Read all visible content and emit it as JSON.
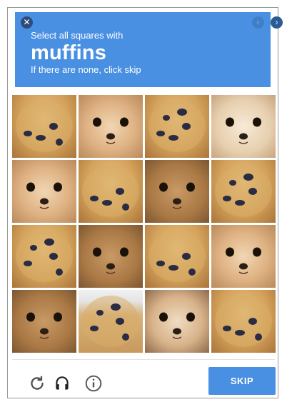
{
  "header": {
    "instruction_line": "Select all squares with",
    "target_word": "muffins",
    "hint_line": "If there are none, click skip",
    "close_icon": "close-icon",
    "prev_icon": "chevron-left-icon",
    "next_icon": "chevron-right-icon"
  },
  "grid": {
    "tiles": [
      {
        "kind": "muffin",
        "subject": "blueberry muffin"
      },
      {
        "kind": "dog",
        "subject": "chihuahua"
      },
      {
        "kind": "muffin",
        "subject": "blueberry muffin"
      },
      {
        "kind": "dog",
        "subject": "chihuahua"
      },
      {
        "kind": "dog",
        "subject": "chihuahua"
      },
      {
        "kind": "muffin",
        "subject": "blueberry muffin"
      },
      {
        "kind": "dog",
        "subject": "chihuahua"
      },
      {
        "kind": "muffin",
        "subject": "blueberry muffin"
      },
      {
        "kind": "muffin",
        "subject": "blueberry muffin"
      },
      {
        "kind": "dog",
        "subject": "chihuahua"
      },
      {
        "kind": "muffin",
        "subject": "blueberry muffin"
      },
      {
        "kind": "dog",
        "subject": "chihuahua"
      },
      {
        "kind": "dog",
        "subject": "chihuahua"
      },
      {
        "kind": "muffin",
        "subject": "blueberry muffins"
      },
      {
        "kind": "dog",
        "subject": "chihuahuas"
      },
      {
        "kind": "muffin",
        "subject": "blueberry muffin"
      }
    ]
  },
  "footer": {
    "reload_icon": "reload-icon",
    "audio_icon": "headphones-icon",
    "info_icon": "info-icon",
    "skip_label": "SKIP"
  },
  "colors": {
    "accent": "#4a90e2",
    "banner_text": "#ffffff",
    "icon_gray": "#555555"
  }
}
